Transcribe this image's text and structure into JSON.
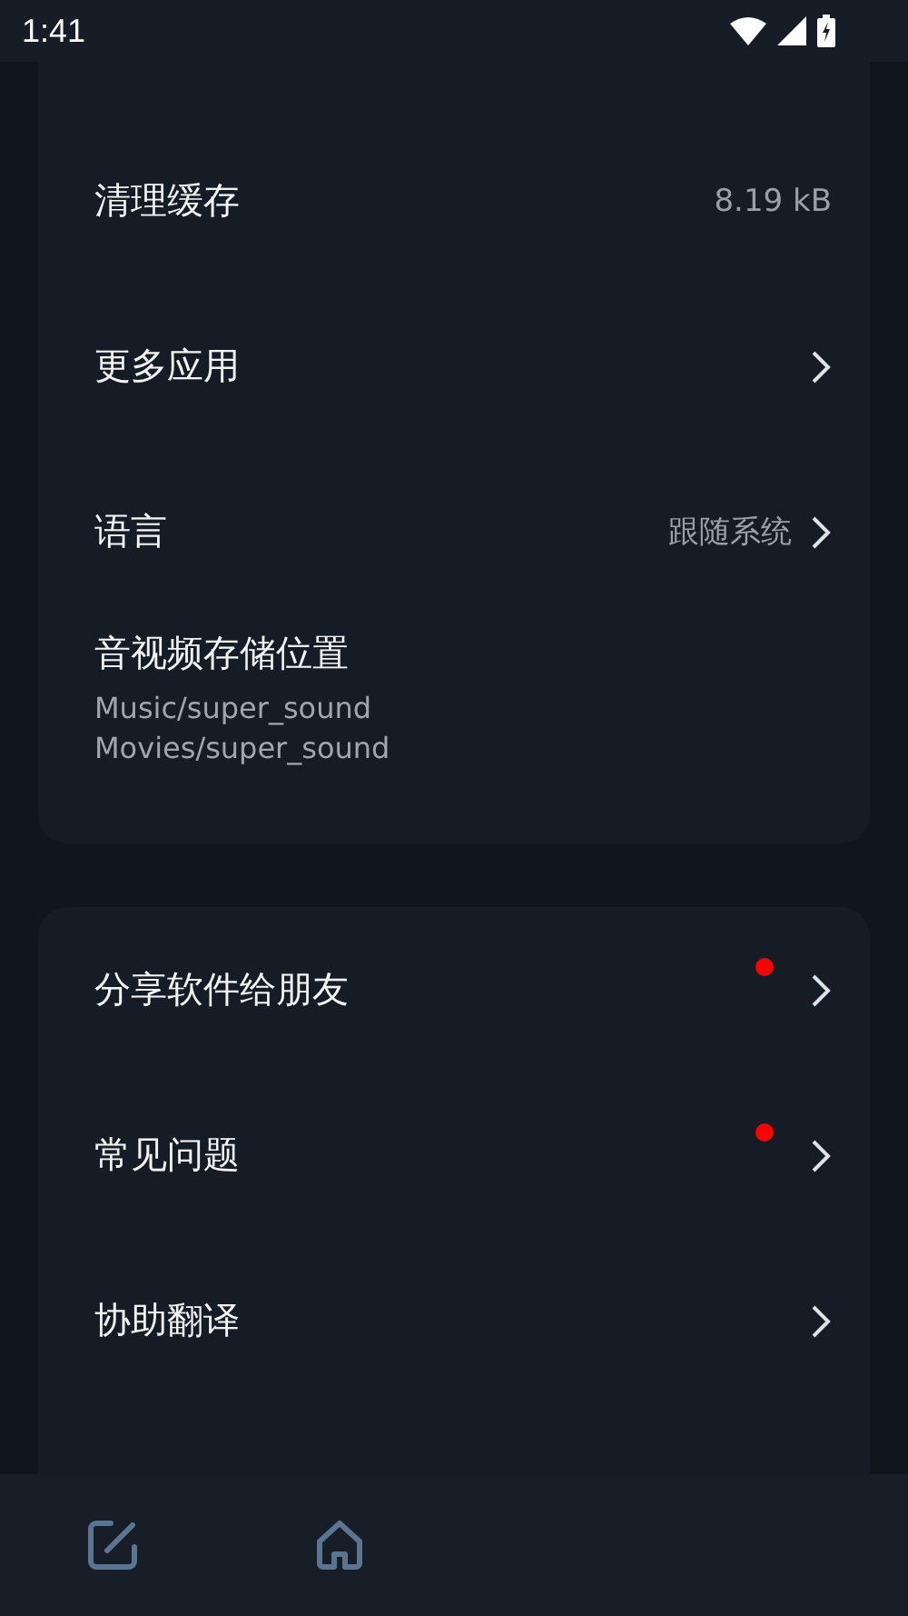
{
  "status_bar": {
    "time": "1:41"
  },
  "groups": [
    {
      "items": [
        {
          "title": "清理缓存",
          "value": "8.19 kB",
          "chevron": false,
          "badge": false
        },
        {
          "title": "更多应用",
          "chevron": true,
          "badge": false
        },
        {
          "title": "语言",
          "value": "跟随系统",
          "chevron": true,
          "badge": false
        },
        {
          "title": "音视频存储位置",
          "subtitles": [
            "Music/super_sound",
            "Movies/super_sound"
          ],
          "chevron": false,
          "badge": false
        }
      ]
    },
    {
      "items": [
        {
          "title": "分享软件给朋友",
          "chevron": true,
          "badge": true
        },
        {
          "title": "常见问题",
          "chevron": true,
          "badge": true
        },
        {
          "title": "协助翻译",
          "chevron": true,
          "badge": false
        }
      ]
    }
  ],
  "bottom_nav": [
    {
      "kind": "edit"
    },
    {
      "kind": "home"
    }
  ]
}
